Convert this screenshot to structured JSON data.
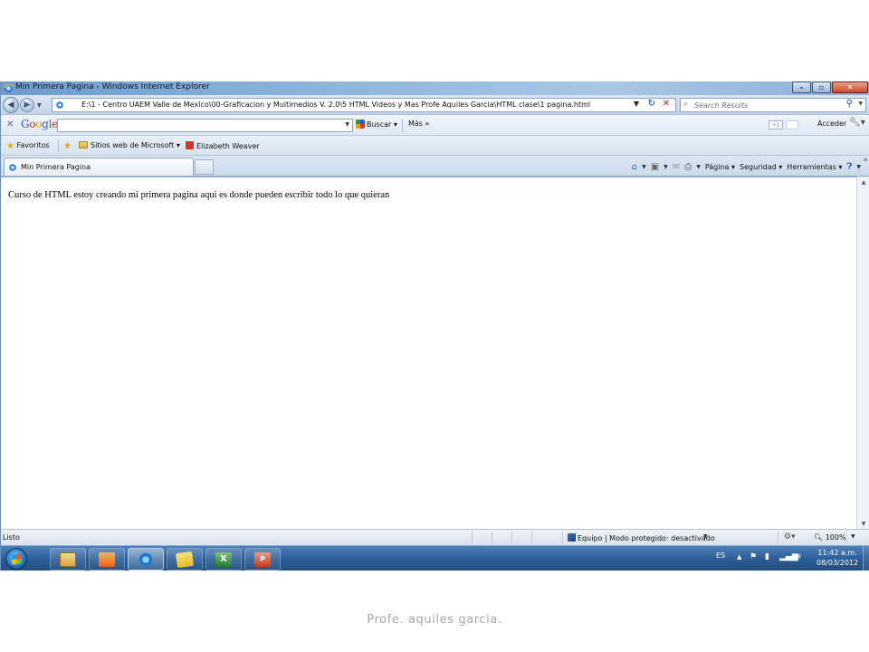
{
  "window": {
    "title": "Min Primera Pagina - Windows Internet Explorer"
  },
  "address_bar": {
    "url": "E:\\1 - Centro UAEM Valle de Mexico\\00-Graficacion y Multimedios V. 2.0\\5 HTML Videos y Mas  Profe Aquiles Garcia\\HTML clase\\1 pagina.html",
    "search_placeholder": "Search Results"
  },
  "google_toolbar": {
    "logo": [
      "G",
      "o",
      "o",
      "g",
      "l",
      "e"
    ],
    "buscar_label": "Buscar",
    "mas_label": "Más",
    "plus_one": "+1",
    "acceder_label": "Acceder"
  },
  "favorites_bar": {
    "favoritos_label": "Favoritos",
    "items": [
      "Sitios web de Microsoft",
      "Elizabeth Weaver"
    ]
  },
  "tabs": [
    {
      "label": "Min Primera Pagina"
    }
  ],
  "command_bar": {
    "pagina_label": "Página",
    "seguridad_label": "Seguridad",
    "herramientas_label": "Herramientas"
  },
  "page": {
    "body_text": "Curso de HTML estoy creando mi primera pagina aqui es donde pueden escribir todo lo que quieran"
  },
  "status_bar": {
    "status_text": "Listo",
    "zone_text": "Equipo | Modo protegido: desactivado",
    "zoom_text": "100%"
  },
  "taskbar": {
    "apps": [
      "windows-explorer-icon",
      "media-player-icon",
      "internet-explorer-icon",
      "sticky-notes-icon",
      "excel-icon",
      "powerpoint-icon"
    ],
    "excel_glyph": "X",
    "ppt_glyph": "P",
    "language": "ES",
    "time": "11:42 a.m.",
    "date": "08/03/2012"
  },
  "caption": "Profe. aquiles garcia.",
  "colors": {
    "titlebar": "#8fb6dc",
    "taskbar": "#2a5c96",
    "caption": "#a7a7a7"
  }
}
